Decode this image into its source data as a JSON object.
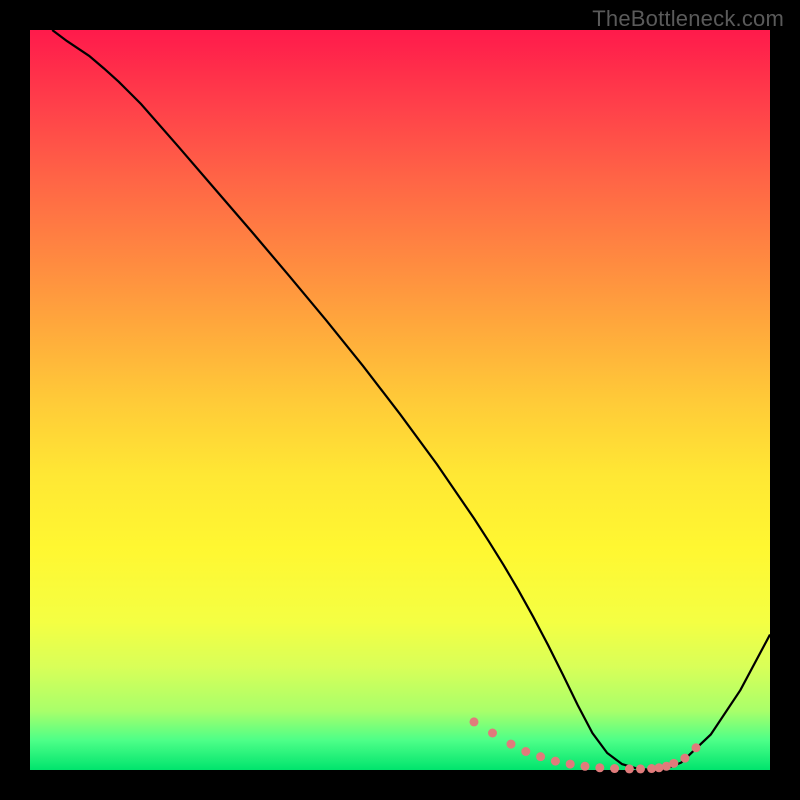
{
  "watermark": "TheBottleneck.com",
  "chart_data": {
    "type": "line",
    "title": "",
    "xlabel": "",
    "ylabel": "",
    "xlim": [
      0,
      100
    ],
    "ylim": [
      0,
      100
    ],
    "grid": false,
    "series": [
      {
        "name": "curve",
        "color": "#000000",
        "x": [
          3,
          5,
          8,
          10,
          12,
          15,
          20,
          25,
          30,
          35,
          40,
          45,
          50,
          55,
          60,
          62,
          64,
          66,
          68,
          70,
          72,
          74,
          76,
          78,
          80,
          82,
          84,
          86,
          88,
          92,
          96,
          100
        ],
        "values": [
          100,
          98.5,
          96.5,
          94.8,
          93,
          90,
          84.3,
          78.5,
          72.7,
          66.8,
          60.8,
          54.6,
          48.1,
          41.3,
          34,
          30.9,
          27.7,
          24.3,
          20.7,
          16.9,
          12.9,
          8.8,
          5,
          2.3,
          0.8,
          0.2,
          0,
          0.2,
          1.0,
          4.8,
          10.8,
          18.3
        ]
      }
    ],
    "markers": {
      "name": "dotted-region",
      "color": "#e07b7b",
      "x": [
        60,
        62.5,
        65,
        67,
        69,
        71,
        73,
        75,
        77,
        79,
        81,
        82.5,
        84,
        85,
        86,
        87,
        88.5,
        90
      ],
      "values": [
        6.5,
        5.0,
        3.5,
        2.5,
        1.8,
        1.2,
        0.8,
        0.5,
        0.3,
        0.2,
        0.15,
        0.15,
        0.2,
        0.3,
        0.5,
        0.9,
        1.6,
        3.0
      ]
    }
  }
}
